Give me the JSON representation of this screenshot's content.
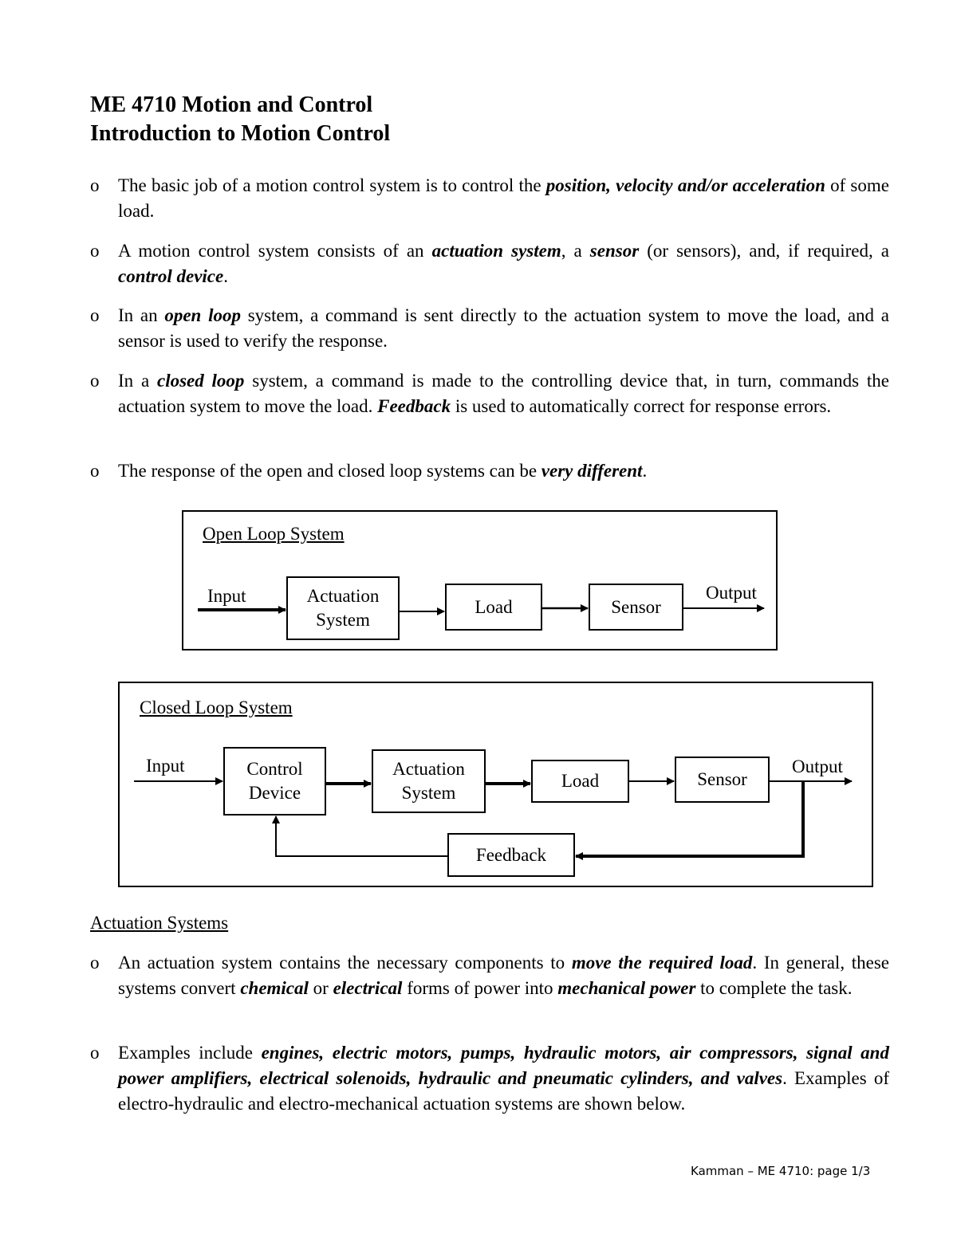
{
  "title": {
    "line1": "ME 4710 Motion and Control",
    "line2": "Introduction to Motion Control"
  },
  "bullet_marker": "o",
  "intro_bullets": [
    [
      {
        "t": "The basic job of a motion control system is to control the "
      },
      {
        "t": "position, velocity and/or acceleration",
        "b": true
      },
      {
        "t": " of some load."
      }
    ],
    [
      {
        "t": "A motion control system consists of an "
      },
      {
        "t": "actuation system",
        "b": true
      },
      {
        "t": ", a "
      },
      {
        "t": "sensor",
        "b": true
      },
      {
        "t": " (or sensors), and, if required, a "
      },
      {
        "t": "control device",
        "b": true
      },
      {
        "t": "."
      }
    ],
    [
      {
        "t": "In an "
      },
      {
        "t": "open loop",
        "b": true
      },
      {
        "t": " system, a command is sent directly to the actuation system to move the load, and a sensor is used to verify the response."
      }
    ],
    [
      {
        "t": "In a "
      },
      {
        "t": "closed loop",
        "b": true
      },
      {
        "t": " system, a command is made to the controlling device that, in turn, commands the actuation system to move the load.  "
      },
      {
        "t": "Feedback",
        "b": true
      },
      {
        "t": " is used to automatically correct for response errors."
      }
    ],
    [
      {
        "t": "The response of the open and closed loop systems can be "
      },
      {
        "t": "very different",
        "b": true
      },
      {
        "t": "."
      }
    ]
  ],
  "open_loop": {
    "title": "Open Loop System",
    "input": "Input",
    "actuation": "Actuation System",
    "load": "Load",
    "sensor": "Sensor",
    "output": "Output"
  },
  "closed_loop": {
    "title": "Closed Loop System",
    "input": "Input",
    "control": "Control Device",
    "actuation": "Actuation System",
    "load": "Load",
    "sensor": "Sensor",
    "output": "Output",
    "feedback": "Feedback"
  },
  "actuation_heading": "Actuation Systems",
  "actuation_bullets": [
    [
      {
        "t": "An actuation system contains the necessary components to "
      },
      {
        "t": "move the required load",
        "b": true
      },
      {
        "t": ".  In general, these systems convert "
      },
      {
        "t": "chemical",
        "b": true
      },
      {
        "t": " or "
      },
      {
        "t": "electrical",
        "b": true
      },
      {
        "t": " forms of power into "
      },
      {
        "t": "mechanical power",
        "b": true
      },
      {
        "t": " to complete the task."
      }
    ],
    [
      {
        "t": "Examples include "
      },
      {
        "t": "engines, electric motors, pumps, hydraulic motors, air compressors, signal and power amplifiers, electrical solenoids, hydraulic and pneumatic cylinders, and valves",
        "b": true
      },
      {
        "t": ".  Examples of electro-hydraulic and electro-mechanical actuation systems are shown below."
      }
    ]
  ],
  "footer": "Kamman – ME 4710: page 1/3"
}
